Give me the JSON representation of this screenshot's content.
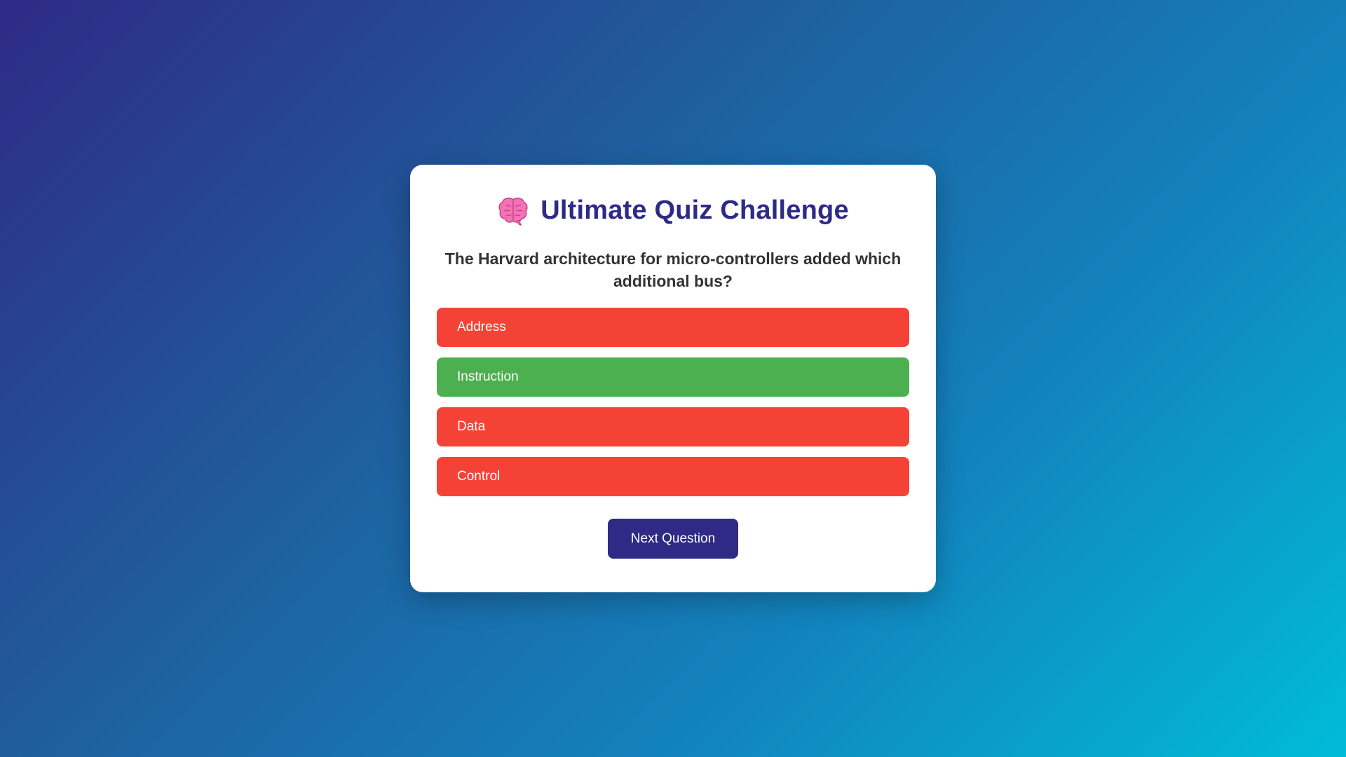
{
  "quiz": {
    "title": "Ultimate Quiz Challenge",
    "title_icon": "brain-icon",
    "question": "The Harvard architecture for micro-controllers added which additional bus?",
    "answers": [
      {
        "label": "Address",
        "state": "wrong",
        "color": "#f44336"
      },
      {
        "label": "Instruction",
        "state": "correct",
        "color": "#4caf50"
      },
      {
        "label": "Data",
        "state": "wrong",
        "color": "#f44336"
      },
      {
        "label": "Control",
        "state": "wrong",
        "color": "#f44336"
      }
    ],
    "next_label": "Next Question"
  },
  "colors": {
    "accent": "#2e2a85",
    "correct": "#4caf50",
    "wrong": "#f44336",
    "background_start": "#2e2a85",
    "background_end": "#00bcd6"
  }
}
